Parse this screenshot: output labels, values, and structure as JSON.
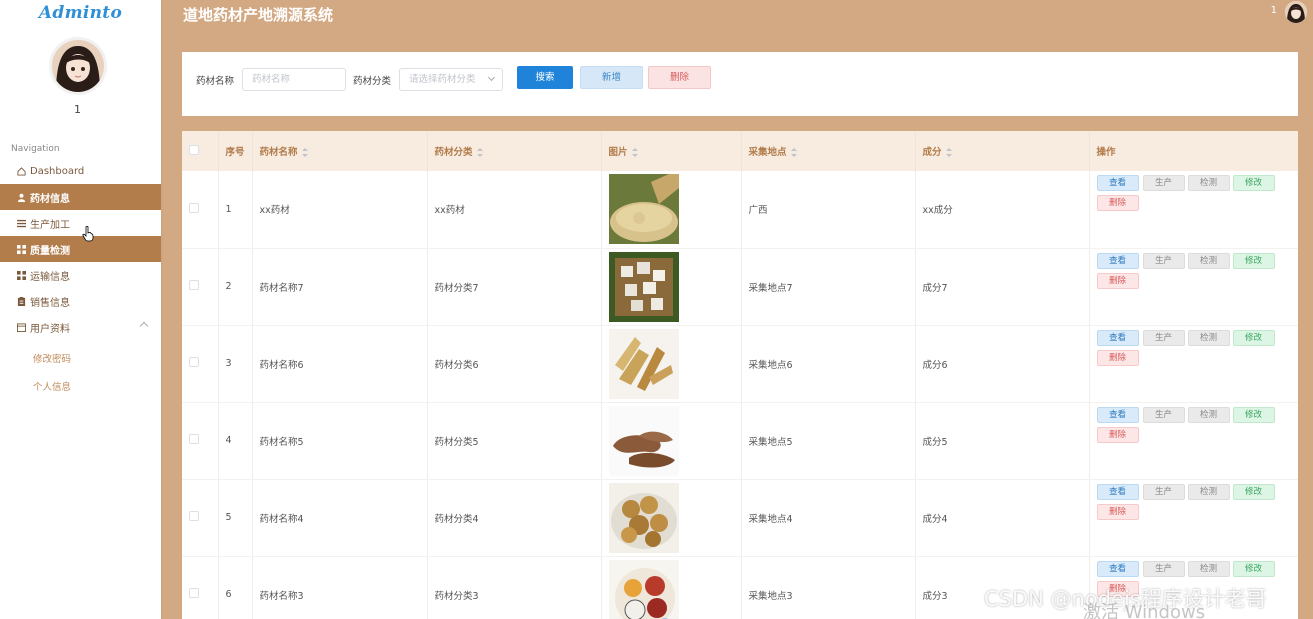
{
  "app": {
    "logo": "Adminto",
    "title": "道地药材产地溯源系统",
    "user_name": "1",
    "top_user": "1"
  },
  "sidebar": {
    "nav_label": "Navigation",
    "items": [
      {
        "label": "Dashboard",
        "icon": "home-icon"
      },
      {
        "label": "药材信息",
        "icon": "user-icon"
      },
      {
        "label": "生产加工",
        "icon": "list-icon"
      },
      {
        "label": "质量检测",
        "icon": "grid-icon"
      },
      {
        "label": "运输信息",
        "icon": "grid-icon"
      },
      {
        "label": "销售信息",
        "icon": "clipboard-icon"
      },
      {
        "label": "用户资料",
        "icon": "calendar-icon"
      }
    ],
    "sub_items": [
      {
        "label": "修改密码"
      },
      {
        "label": "个人信息"
      }
    ]
  },
  "search": {
    "name_label": "药材名称",
    "name_placeholder": "药材名称",
    "category_label": "药材分类",
    "category_placeholder": "请选择药材分类",
    "search_button": "搜索",
    "add_button": "新增",
    "delete_button": "删除"
  },
  "table": {
    "headers": [
      "序号",
      "药材名称",
      "药材分类",
      "图片",
      "采集地点",
      "成分",
      "操作"
    ],
    "op_labels": {
      "view": "查看",
      "produce": "生产",
      "test": "检测",
      "edit": "修改",
      "delete": "删除"
    },
    "rows": [
      {
        "no": "1",
        "name": "xx药材",
        "category": "xx药材",
        "location": "广西",
        "component": "xx成分"
      },
      {
        "no": "2",
        "name": "药材名称7",
        "category": "药材分类7",
        "location": "采集地点7",
        "component": "成分7"
      },
      {
        "no": "3",
        "name": "药材名称6",
        "category": "药材分类6",
        "location": "采集地点6",
        "component": "成分6"
      },
      {
        "no": "4",
        "name": "药材名称5",
        "category": "药材分类5",
        "location": "采集地点5",
        "component": "成分5"
      },
      {
        "no": "5",
        "name": "药材名称4",
        "category": "药材分类4",
        "location": "采集地点4",
        "component": "成分4"
      },
      {
        "no": "6",
        "name": "药材名称3",
        "category": "药材分类3",
        "location": "采集地点3",
        "component": "成分3"
      }
    ]
  },
  "watermarks": {
    "csdn": "CSDN @nodejs程序设计老哥",
    "windows": "激活 Windows"
  },
  "colors": {
    "sidebar_active": "#b27c4b",
    "page_bg": "#d3a984",
    "primary": "#1f84d9",
    "header_text": "#b27c4b"
  }
}
